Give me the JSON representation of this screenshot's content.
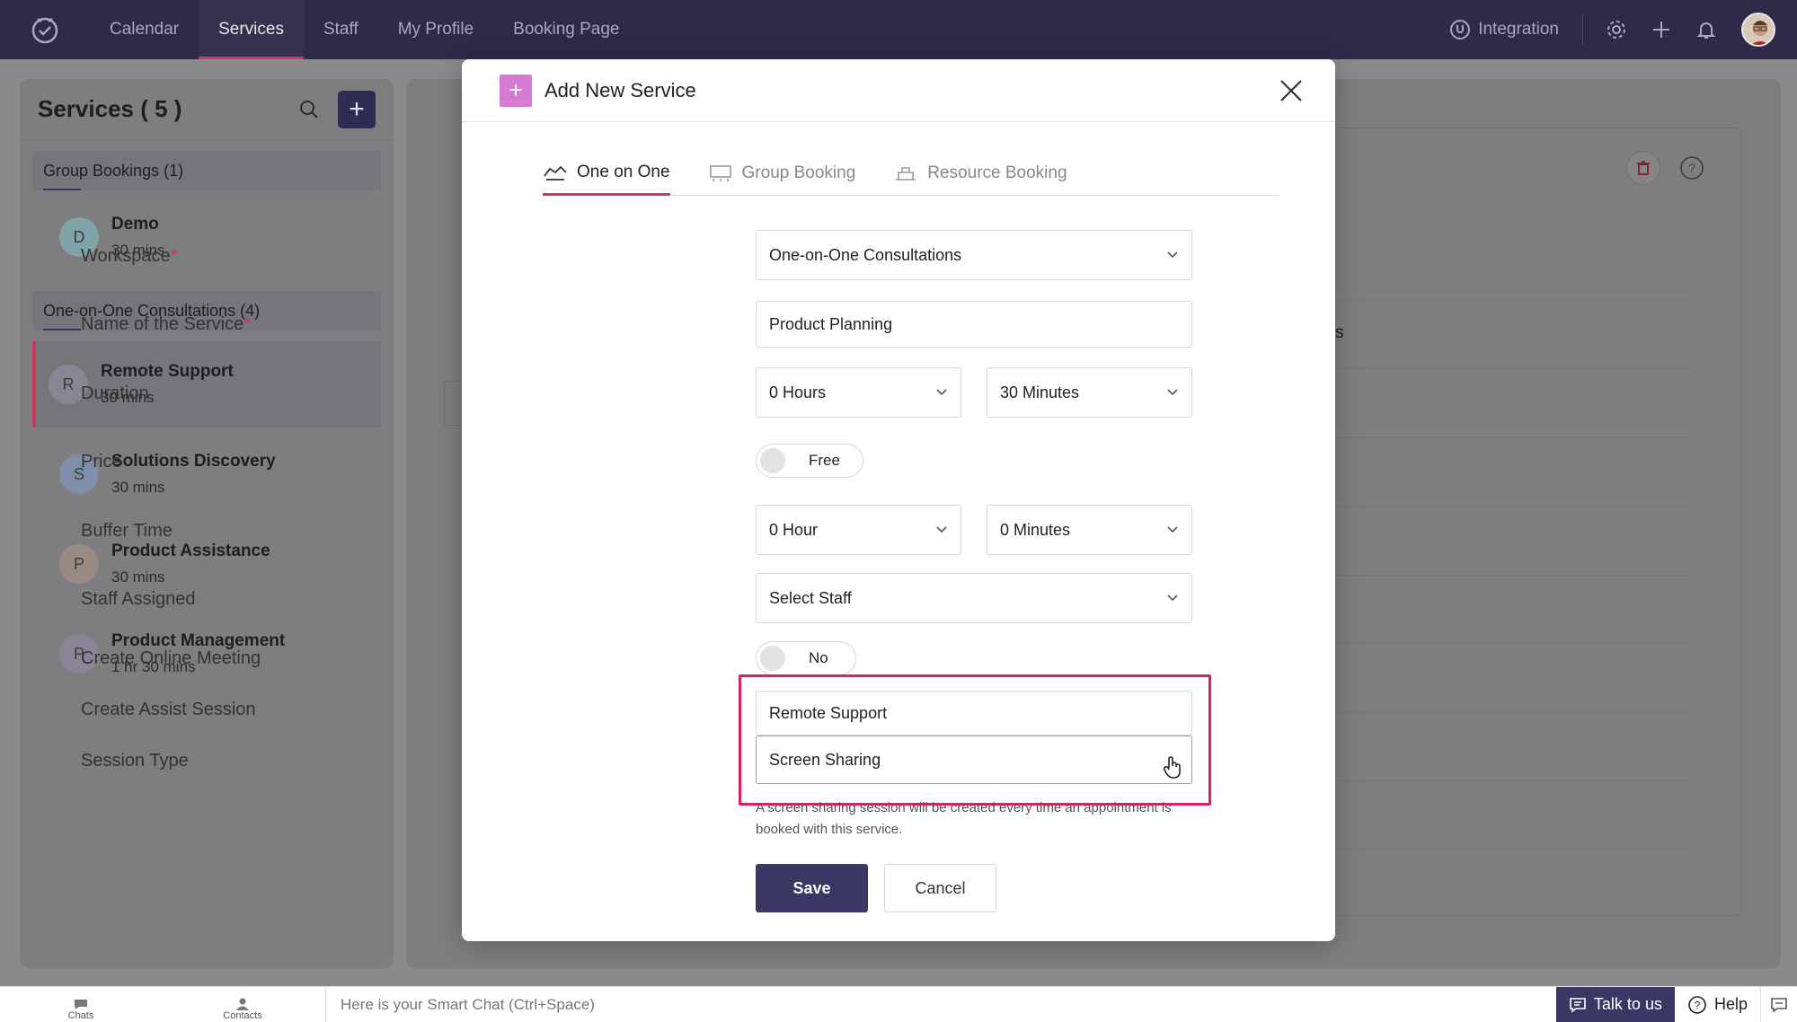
{
  "nav": {
    "items": [
      {
        "label": "Calendar",
        "active": false
      },
      {
        "label": "Services",
        "active": true
      },
      {
        "label": "Staff",
        "active": false
      },
      {
        "label": "My Profile",
        "active": false
      },
      {
        "label": "Booking Page",
        "active": false
      }
    ],
    "integration": "Integration"
  },
  "sidebar": {
    "title": "Services ( 5 )",
    "groups": [
      {
        "label": "Group Bookings (1)"
      },
      {
        "label": "One-on-One Consultations (4)"
      }
    ],
    "services": [
      {
        "initial": "D",
        "name": "Demo",
        "duration": "30 mins",
        "color": "#7fa3a6"
      },
      {
        "initial": "R",
        "name": "Remote Support",
        "duration": "30 mins",
        "color": "#8a8592"
      },
      {
        "initial": "S",
        "name": "Solutions Discovery",
        "duration": "30 mins",
        "color": "#7f8fa8"
      },
      {
        "initial": "P",
        "name": "Product Assistance",
        "duration": "30 mins",
        "color": "#9a8a86"
      },
      {
        "initial": "P",
        "name": "Product Management",
        "duration": "1 hr 30 mins",
        "color": "#8a8496"
      }
    ]
  },
  "background": {
    "partial_text": "s"
  },
  "modal": {
    "title": "Add New Service",
    "tabs": [
      {
        "label": "One on One",
        "active": true
      },
      {
        "label": "Group Booking",
        "active": false
      },
      {
        "label": "Resource Booking",
        "active": false
      }
    ],
    "fields": {
      "workspace_label": "Workspace",
      "workspace_value": "One-on-One Consultations",
      "name_label": "Name of the Service",
      "name_value": "Product Planning",
      "duration_label": "Duration",
      "duration_hours": "0 Hours",
      "duration_minutes": "30 Minutes",
      "price_label": "Price",
      "price_toggle": "Free",
      "buffer_label": "Buffer Time",
      "buffer_hours": "0 Hour",
      "buffer_minutes": "0 Minutes",
      "staff_label": "Staff Assigned",
      "staff_value": "Select Staff",
      "meeting_label": "Create Online Meeting",
      "meeting_toggle": "No",
      "assist_label": "Create Assist Session",
      "assist_value": "Remote Support",
      "session_label": "Session Type",
      "session_value": "Screen Sharing",
      "help_text": "A screen sharing session will be created every time an appointment is booked with this service.",
      "required_mark": "*"
    },
    "save_label": "Save",
    "cancel_label": "Cancel"
  },
  "bottombar": {
    "chats": "Chats",
    "contacts": "Contacts",
    "smart_chat": "Here is your Smart Chat (Ctrl+Space)",
    "talk": "Talk to us",
    "help": "Help"
  },
  "colors": {
    "nav_bg": "#2d2a4a",
    "accent": "#c83a5a",
    "primary": "#3b3764",
    "highlight": "#e01e5a"
  }
}
